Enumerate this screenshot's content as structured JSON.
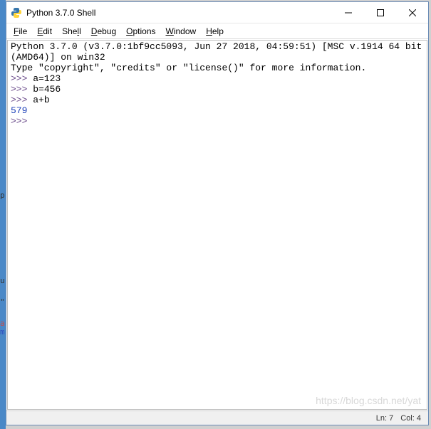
{
  "window": {
    "title": "Python 3.7.0 Shell"
  },
  "menu": {
    "file": "File",
    "edit": "Edit",
    "shell": "Shell",
    "debug": "Debug",
    "options": "Options",
    "window": "Window",
    "help": "Help"
  },
  "shell": {
    "header_line1": "Python 3.7.0 (v3.7.0:1bf9cc5093, Jun 27 2018, 04:59:51) [MSC v.1914 64 bit (AMD64)] on win32",
    "header_line2": "Type \"copyright\", \"credits\" or \"license()\" for more information.",
    "prompt": ">>>",
    "line1": "a=123",
    "line2": "b=456",
    "line3": "a+b",
    "result": "579"
  },
  "status": {
    "ln_label": "Ln:",
    "ln_value": "7",
    "col_label": "Col:",
    "col_value": "4"
  },
  "watermark": "https://blog.csdn.net/yat"
}
